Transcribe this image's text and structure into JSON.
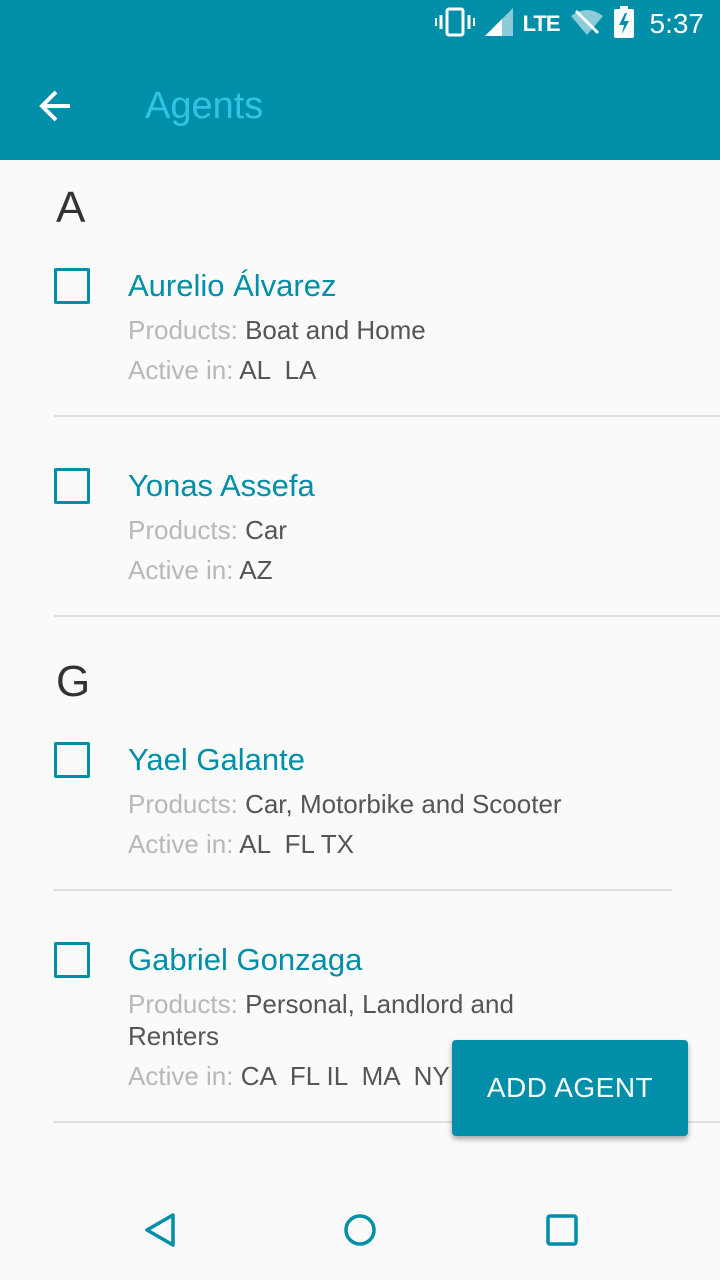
{
  "status_bar": {
    "network": "LTE",
    "time": "5:37",
    "icons": [
      "vibrate-icon",
      "signal-icon",
      "wifi-off-icon",
      "battery-charging-icon"
    ]
  },
  "app_bar": {
    "title": "Agents",
    "back_icon": "arrow-back-icon"
  },
  "sections": [
    {
      "letter": "A",
      "agents": [
        {
          "name": "Aurelio Álvarez",
          "products_label": "Products:",
          "products": "Boat and Home",
          "active_label": "Active in:",
          "active_in": "AL  LA",
          "checked": false
        },
        {
          "name": "Yonas Assefa",
          "products_label": "Products:",
          "products": "Car",
          "active_label": "Active in:",
          "active_in": "AZ",
          "checked": false
        }
      ]
    },
    {
      "letter": "G",
      "agents": [
        {
          "name": "Yael Galante",
          "products_label": "Products:",
          "products": "Car, Motorbike and Scooter",
          "active_label": "Active in:",
          "active_in": "AL  FL TX",
          "checked": false
        },
        {
          "name": "Gabriel Gonzaga",
          "products_label": "Products:",
          "products": "Personal, Landlord and Renters",
          "active_label": "Active in:",
          "active_in": "CA  FL IL  MA  NY",
          "checked": false
        }
      ]
    }
  ],
  "fab": {
    "label": "ADD AGENT"
  },
  "nav_bar": {
    "icons": [
      "back-triangle-icon",
      "home-circle-icon",
      "recents-square-icon"
    ]
  },
  "colors": {
    "primary": "#008ea8",
    "title": "#2ec4e6",
    "background": "#fafafa",
    "label_gray": "#b8b8b8",
    "value_gray": "#555555"
  }
}
